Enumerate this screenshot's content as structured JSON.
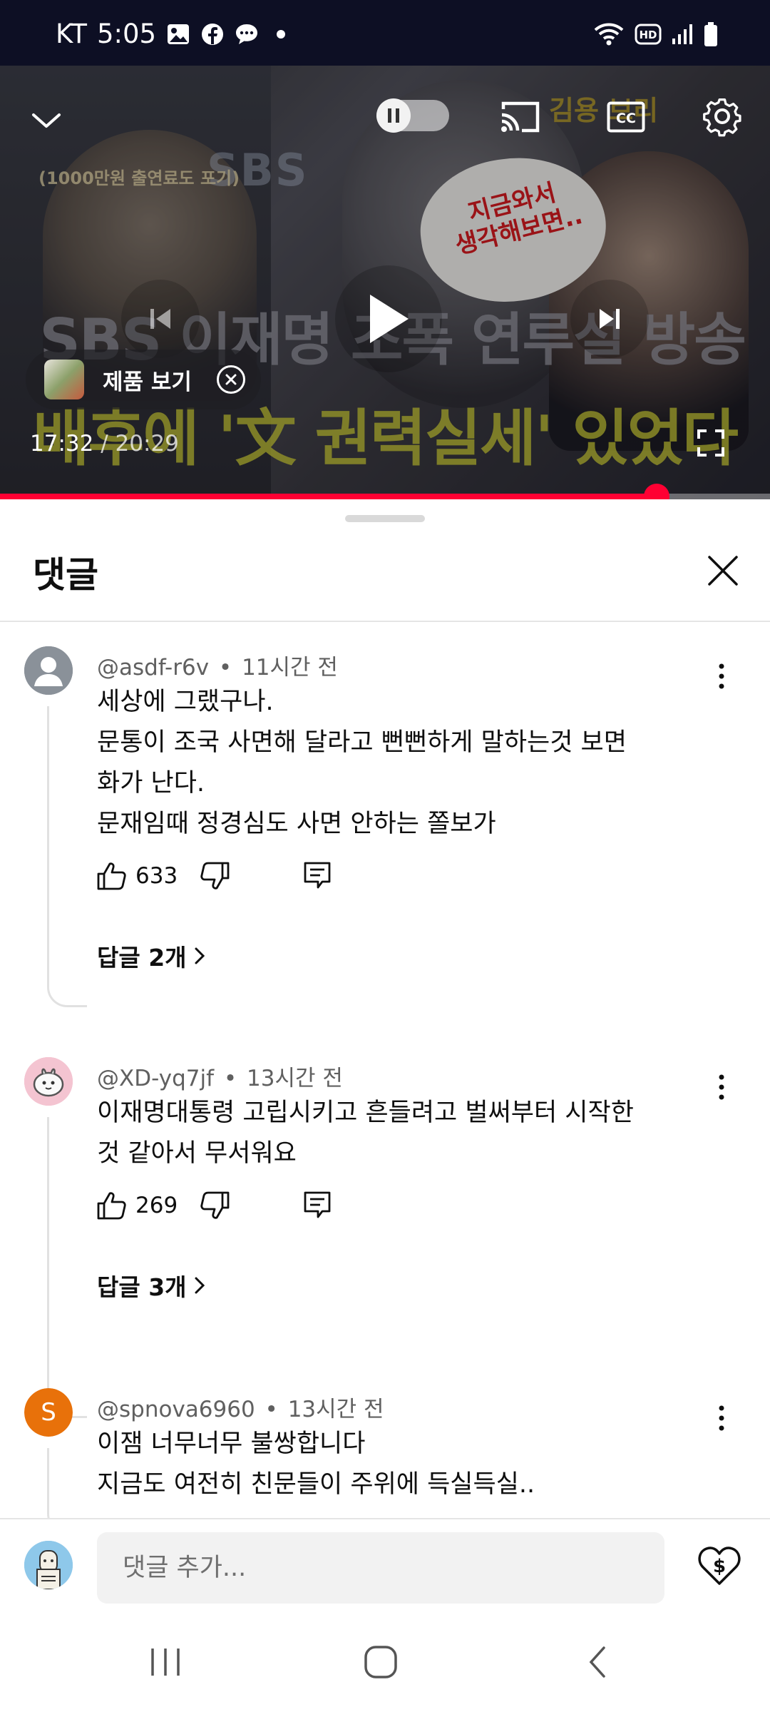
{
  "status_bar": {
    "carrier": "KT",
    "time": "5:05",
    "left_icons": [
      "gallery-icon",
      "facebook-icon",
      "chat-icon",
      "dot-icon"
    ],
    "right_icons": [
      "wifi-icon",
      "hd-icon",
      "signal-icon",
      "battery-icon"
    ]
  },
  "player": {
    "overlay": {
      "tag": "(1000만원 출연료도 포기)",
      "broadcaster_mark": "SBS",
      "speech_bubble_lines": [
        "지금와서",
        "생각해보면.."
      ],
      "brand_partial": "김용 브리",
      "title_line1": "SBS 이재명 조폭 연루설 방송",
      "title_line2": "배후에 '文 권력실세' 있었다"
    },
    "product_chip_label": "제품 보기",
    "current_time": "17:32",
    "time_separator": " / ",
    "duration": "20:29",
    "progress_fraction": 0.853,
    "autoplay": "on",
    "accent_color": "#ff0033"
  },
  "comments_sheet": {
    "title": "댓글",
    "comments": [
      {
        "author": "@asdf-r6v",
        "time_ago": "11시간 전",
        "lines": [
          "세상에 그랬구나.",
          "문통이 조국 사면해 달라고 뻔뻔하게 말하는것 보면",
          "화가 난다.",
          "문재임때 정경심도 사면 안하는 쫄보가"
        ],
        "likes": "633",
        "replies_label": "답글 2개",
        "avatar": "default-person"
      },
      {
        "author": "@XD-yq7jf",
        "time_ago": "13시간 전",
        "lines": [
          "이재명대통령  고립시키고 흔들려고 벌써부터  시작한",
          "것 같아서 무서워요"
        ],
        "likes": "269",
        "replies_label": "답글 3개",
        "avatar": "pink-character"
      },
      {
        "author": "@spnova6960",
        "time_ago": "13시간 전",
        "lines": [
          "이잼 너무너무 불쌍합니다",
          "지금도 여전히 친문들이 주위에 득실득실.."
        ],
        "avatar_letter": "S",
        "avatar_color": "#e8710a"
      }
    ]
  },
  "input_bar": {
    "placeholder": "댓글 추가..."
  },
  "meta_sep": "•"
}
